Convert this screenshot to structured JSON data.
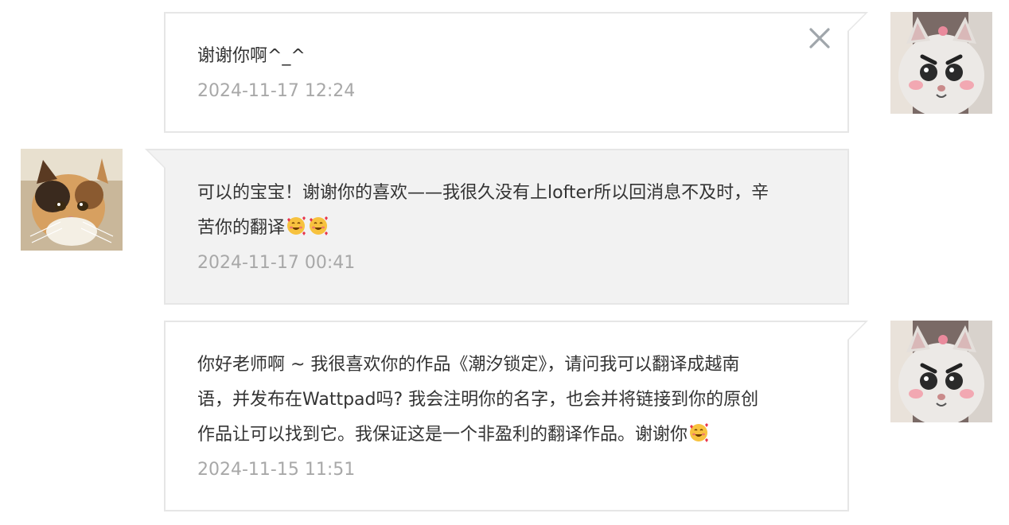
{
  "messages": [
    {
      "direction": "sent",
      "text": "谢谢你啊^_^",
      "time": "2024-11-17 12:24",
      "has_close": true
    },
    {
      "direction": "received",
      "text_line1": "可以的宝宝！谢谢你的喜欢——我很久没有上lofter所以回消息不及时，辛",
      "text_line2": "苦你的翻译",
      "emojis": [
        "smiling-face-with-hearts-icon",
        "smiling-face-with-hearts-icon"
      ],
      "time": "2024-11-17 00:41"
    },
    {
      "direction": "sent",
      "text_line1": "你好老师啊 ~ 我很喜欢你的作品《潮汐锁定》，请问我可以翻译成越南",
      "text_line2": "语，并发布在Wattpad吗? 我会注明你的名字，也会并将链接到你的原创",
      "text_line3": "作品让可以找到它。我保证这是一个非盈利的翻译作品。谢谢你",
      "emojis": [
        "smiling-face-with-hearts-icon"
      ],
      "time": "2024-11-15 11:51"
    }
  ],
  "colors": {
    "sent_bubble_bg": "#ffffff",
    "received_bubble_bg": "#f2f2f2",
    "bubble_border": "#e6e6e6",
    "timestamp": "#a8a8a8",
    "text": "#333333",
    "close_icon": "#a0a6ab"
  }
}
